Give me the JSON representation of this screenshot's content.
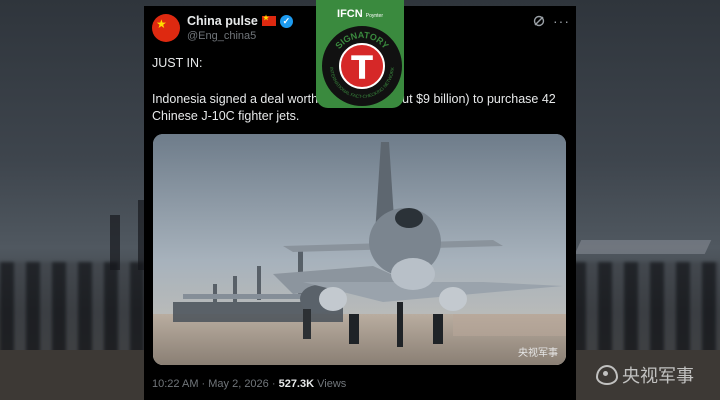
{
  "tweet": {
    "display_name": "China pulse",
    "handle": "@Eng_china5",
    "headline": "JUST IN:",
    "body": "Indonesia signed a deal worth 6... ...uan (about $9 billion) to purchase 42 Chinese J-10C fighter jets.",
    "timestamp": "10:22 AM · May 2, 2026 · ",
    "views_count": "527.3K",
    "views_label": " Views"
  },
  "badge": {
    "top_label": "IFCN",
    "top_small": "Poynter",
    "seal_letter": "T",
    "ring_text_top": "SIGNATORY",
    "ring_text_bottom": "INTERNATIONAL FACT-CHECKING NETWORK"
  },
  "image": {
    "watermark": "央视军事"
  },
  "background": {
    "watermark": "央视军事"
  },
  "icons": {
    "avatar": "china-flag-avatar",
    "flag": "china-flag-icon",
    "verified": "verified-badge-icon",
    "grok": "grok-icon",
    "more": "more-icon",
    "weibo": "weibo-icon"
  },
  "colors": {
    "card_bg": "#000000",
    "verified": "#1d9bf0",
    "badge_green": "#3a8a3e",
    "seal_red": "#d62828"
  }
}
